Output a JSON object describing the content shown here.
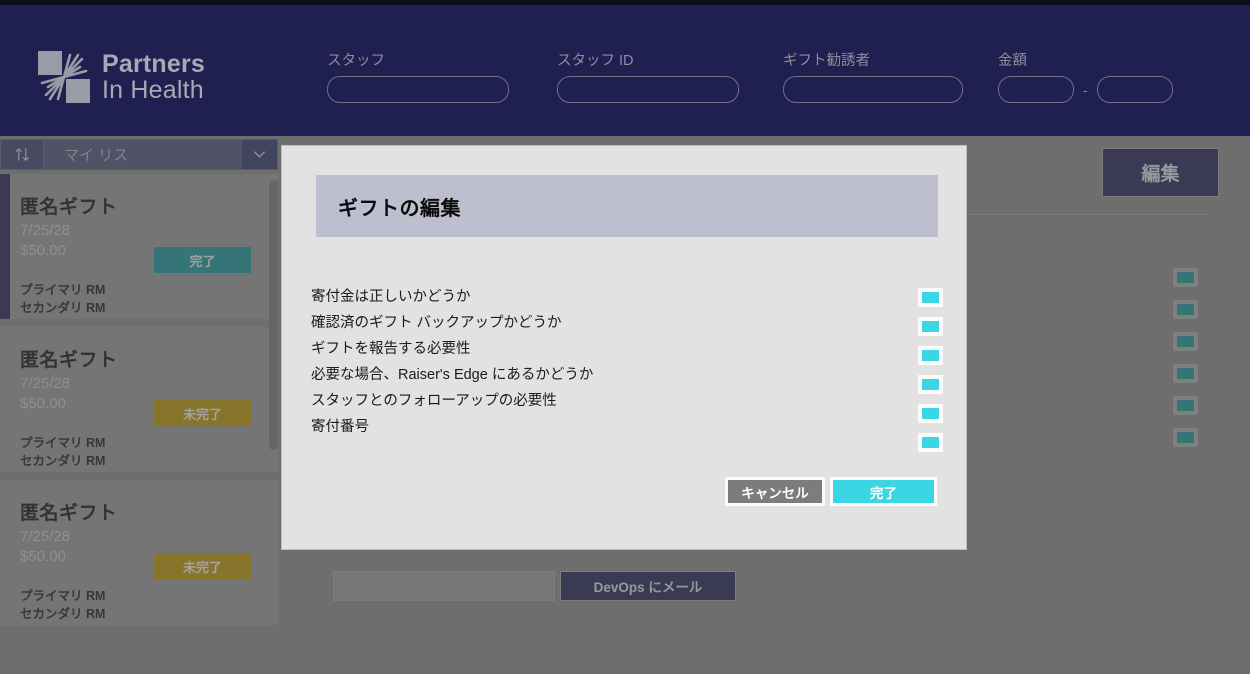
{
  "brand": {
    "logo_icon": "partners-in-health-logo",
    "name_line1": "Partners",
    "name_line2": "In Health"
  },
  "header": {
    "fields": [
      {
        "label": "スタッフ",
        "value": "",
        "placeholder": ""
      },
      {
        "label": "スタッフ ID",
        "value": "",
        "placeholder": ""
      },
      {
        "label": "ギフト勧誘者",
        "value": "",
        "placeholder": ""
      }
    ],
    "amount": {
      "label": "金額",
      "min_value": "",
      "max_value": "",
      "separator": "-"
    }
  },
  "sidebar": {
    "sort_icon": "sort-updown-icon",
    "list_name": "マイ リス",
    "caret_icon": "chevron-down-icon",
    "cards": [
      {
        "title": "匿名ギフト",
        "date": "7/25/28",
        "amount": "$50.00",
        "status": "完了",
        "status_kind": "done",
        "primary_rm": "プライマリ RM",
        "secondary_rm": "セカンダリ RM"
      },
      {
        "title": "匿名ギフト",
        "date": "7/25/28",
        "amount": "$50.00",
        "status": "未完了",
        "status_kind": "pending",
        "primary_rm": "プライマリ RM",
        "secondary_rm": "セカンダリ RM"
      },
      {
        "title": "匿名ギフト",
        "date": "7/25/28",
        "amount": "$50.00",
        "status": "未完了",
        "status_kind": "pending",
        "primary_rm": "プライマリ RM",
        "secondary_rm": "セカンダリ RM"
      }
    ]
  },
  "main": {
    "edit_label": "編集",
    "background_checkbox_count": 6,
    "mail_input_value": "",
    "mail_button_label": "DevOps にメール"
  },
  "modal": {
    "title": "ギフトの編集",
    "checklist": [
      {
        "label": "寄付金は正しいかどうか",
        "checked": true
      },
      {
        "label": "確認済のギフト バックアップかどうか",
        "checked": true
      },
      {
        "label": "ギフトを報告する必要性",
        "checked": true
      },
      {
        "label": "必要な場合、Raiser's Edge にあるかどうか",
        "checked": true
      },
      {
        "label": "スタッフとのフォローアップの必要性",
        "checked": true
      },
      {
        "label": "寄付番号",
        "checked": true
      }
    ],
    "cancel_label": "キャンセル",
    "confirm_label": "完了"
  },
  "colors": {
    "brand_navy": "#1f2050",
    "accent_cyan": "#3bd6e3",
    "status_done": "#17898e",
    "status_pending": "#ab8b04",
    "page_gray": "#7f7f7f",
    "modal_bg": "#e2e2e2",
    "modal_header": "#bebfce"
  }
}
